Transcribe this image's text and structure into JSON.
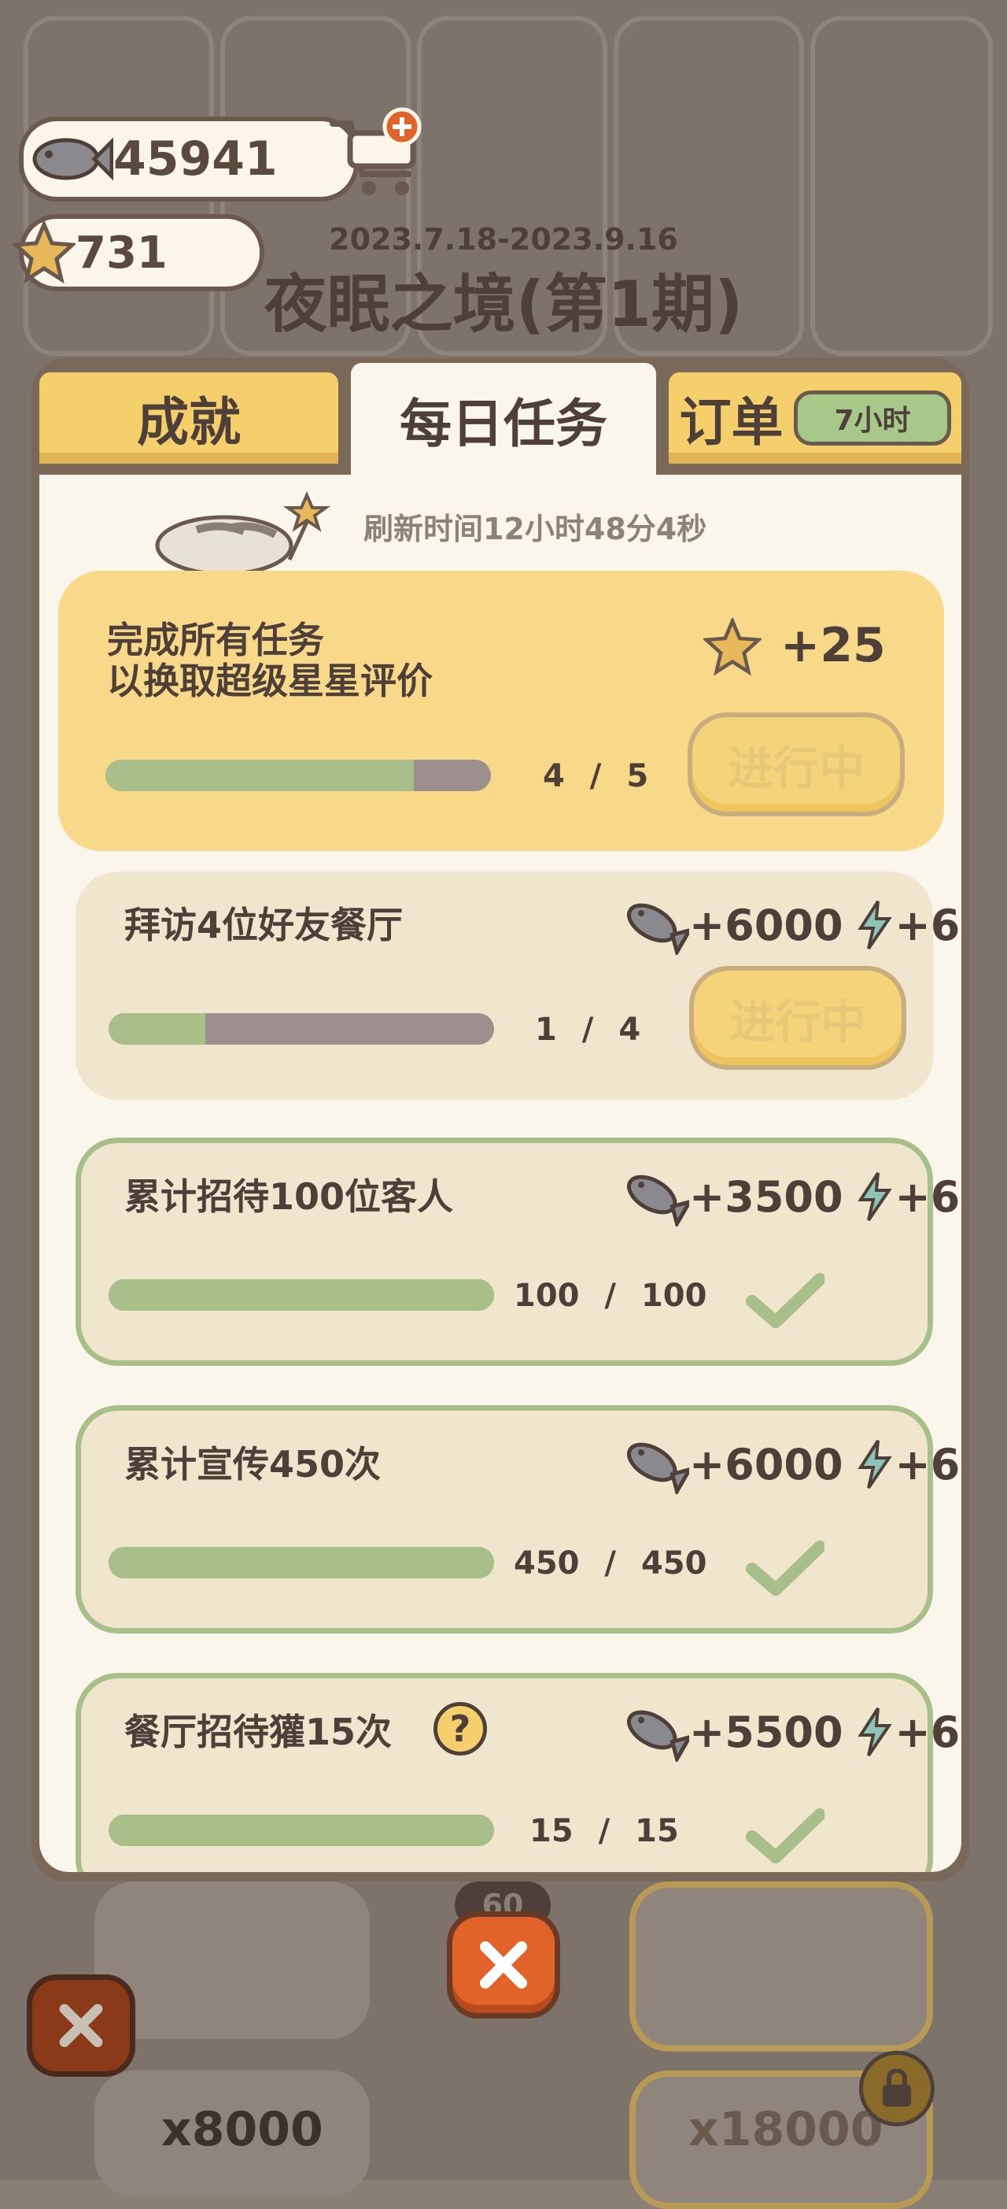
{
  "header": {
    "fish_count": "45941",
    "star_count": "731"
  },
  "event": {
    "period": "2023.7.18-2023.9.16",
    "title": "夜眠之境(第1期)"
  },
  "tabs": [
    {
      "label": "成就"
    },
    {
      "label": "每日任务"
    },
    {
      "label": "订单",
      "badge": "7小时"
    }
  ],
  "refresh_text": "刷新时间12小时48分4秒",
  "summary_task": {
    "title_line1": "完成所有任务",
    "title_line2": "以换取超级星星评价",
    "reward": "+25",
    "progress_current": "4",
    "progress_total": "5",
    "progress_fraction": 0.8,
    "button": "进行中"
  },
  "tasks": [
    {
      "title": "拜访4位好友餐厅",
      "fish_reward": "+6000",
      "energy_reward": "+6",
      "progress_current": "1",
      "progress_total": "4",
      "progress_fraction": 0.25,
      "button": "进行中"
    },
    {
      "title": "累计招待100位客人",
      "fish_reward": "+3500",
      "energy_reward": "+6",
      "progress_current": "100",
      "progress_total": "100",
      "progress_fraction": 1.0
    },
    {
      "title": "累计宣传450次",
      "fish_reward": "+6000",
      "energy_reward": "+6",
      "progress_current": "450",
      "progress_total": "450",
      "progress_fraction": 1.0
    },
    {
      "title": "餐厅招待獾15次",
      "fish_reward": "+5500",
      "energy_reward": "+6",
      "progress_current": "15",
      "progress_total": "15",
      "progress_fraction": 1.0
    }
  ],
  "background": {
    "count_left": "x8000",
    "count_right": "x18000",
    "badge_number": "60"
  },
  "colors": {
    "accent_yellow": "#f5cf6c",
    "progress_green": "#a9bf8a",
    "close_orange": "#e2632a"
  }
}
